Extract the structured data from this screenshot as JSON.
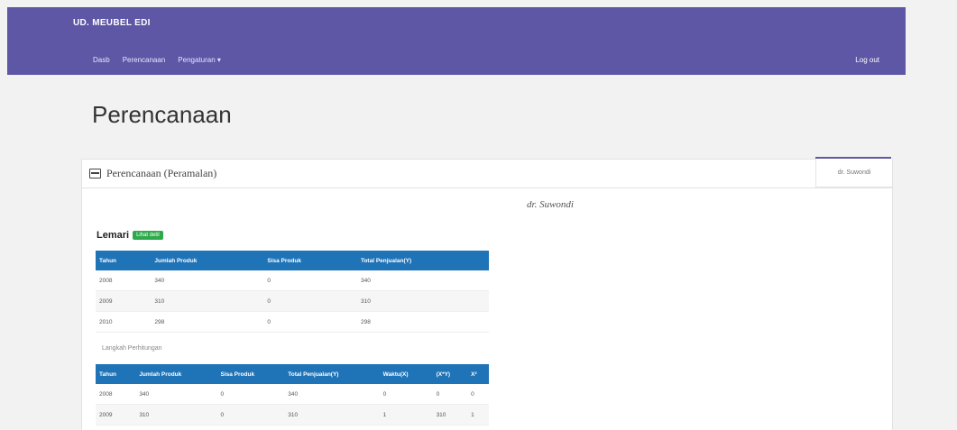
{
  "nav": {
    "brand": "UD. MEUBEL EDI",
    "links": [
      "Dasb",
      "Perencanaan",
      "Pengaturan ▾"
    ],
    "logout": "Log out"
  },
  "page": {
    "title": "Perencanaan"
  },
  "panel": {
    "heading": "Perencanaan (Peramalan)",
    "side_tab": "dr. Suwondi",
    "centered_name": "dr. Suwondi",
    "item": "Lemari",
    "badge": "Lihat detil",
    "subcaption": "Langkah Perhitungan"
  },
  "table1": {
    "headers": [
      "Tahun",
      "Jumlah Produk",
      "Sisa Produk",
      "Total Penjualan(Y)"
    ],
    "rows": [
      [
        "2008",
        "340",
        "0",
        "340"
      ],
      [
        "2009",
        "310",
        "0",
        "310"
      ],
      [
        "2010",
        "298",
        "0",
        "298"
      ]
    ]
  },
  "table2": {
    "headers": [
      "Tahun",
      "Jumlah Produk",
      "Sisa Produk",
      "Total Penjualan(Y)",
      "Waktu(X)",
      "(X*Y)",
      "X²"
    ],
    "rows": [
      [
        "2008",
        "340",
        "0",
        "340",
        "0",
        "0",
        "0"
      ],
      [
        "2009",
        "310",
        "0",
        "310",
        "1",
        "310",
        "1"
      ]
    ]
  },
  "colors": {
    "navbar": "#5d57a6",
    "table_header": "#1f73b7",
    "badge": "#2eaa4c"
  }
}
